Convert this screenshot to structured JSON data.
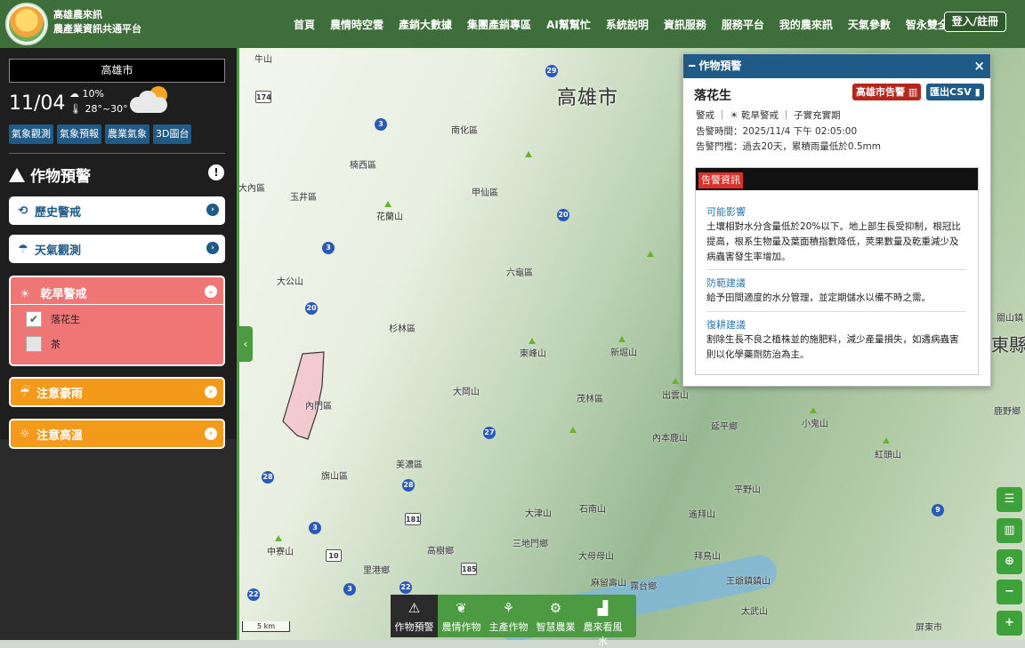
{
  "header": {
    "brand_line1": "高雄農來訊",
    "brand_line2": "農產業資訊共通平台",
    "nav": [
      "首頁",
      "農情時空雲",
      "產銷大數據",
      "集團產銷專區",
      "AI幫幫忙",
      "系統說明",
      "資訊服務",
      "服務平台",
      "我的農來訊",
      "天氣參數",
      "智永雙全"
    ],
    "login_label": "登入/註冊"
  },
  "sidebar": {
    "city": "高雄市",
    "date": "11/04",
    "rain_prob": "10%",
    "temp_range": "28°~30°",
    "weather_tabs": [
      "氣象觀測",
      "氣象預報",
      "農業氣象",
      "3D圖台"
    ],
    "section_title": "作物預警",
    "info_label": "!",
    "menu": {
      "history": "歷史警戒",
      "weather_obs": "天氣觀測",
      "drought": "乾旱警戒",
      "rain": "注意豪雨",
      "heat": "注意高溫"
    },
    "drought_crops": [
      {
        "name": "落花生",
        "checked": true
      },
      {
        "name": "茶",
        "checked": false
      }
    ]
  },
  "map": {
    "city_label": "高雄市",
    "labels": [
      "牛山",
      "甲仙區",
      "南化區",
      "楠西區",
      "大內區",
      "玉井區",
      "花蘭山",
      "大公山",
      "內門區",
      "杉林區",
      "六龜區",
      "茂林區",
      "旗山區",
      "美濃區",
      "高樹鄉",
      "三地門鄉",
      "中寮山",
      "里港鄉",
      "大岡山",
      "東峰山",
      "新堀山",
      "出雲山",
      "內本鹿山",
      "延平鄉",
      "小鬼山",
      "紅頭山",
      "平野山",
      "遙拜山",
      "拜鳥山",
      "大津山",
      "石南山",
      "大母母山",
      "霧台鄉",
      "麻留壽山",
      "王爺鎮鎮山",
      "太武山",
      "屏東市",
      "東縣",
      "鹿野鄉",
      "關山鎮"
    ],
    "scale": "5 km",
    "collapse_label": "‹"
  },
  "popup": {
    "title": "作物預警",
    "close_label": "×",
    "crop": "落花生",
    "btn_city_alert": "高雄市告警",
    "btn_export": "匯出CSV",
    "level": "警戒",
    "alert_type": "乾旱警戒",
    "stage": "子實充實期",
    "time_label": "告警時間：",
    "time_value": "2025/11/4 下午 02:05:00",
    "threshold_label": "告警門檻：",
    "threshold_value": "過去20天，累積雨量低於0.5mm",
    "info_tag": "告警資訊",
    "sections": [
      {
        "title": "可能影響",
        "body": "土壤相對水分含量低於20%以下。地上部生長受抑制，根冠比提高，根系生物量及葉面積指數降低，莢果數量及乾重減少及病蟲害發生率增加。"
      },
      {
        "title": "防範建議",
        "body": "給予田間適度的水分管理，並定期儲水以備不時之需。"
      },
      {
        "title": "復耕建議",
        "body": "割除生長不良之植株並的施肥料，減少產量損失，如遇病蟲害則以化學藥劑防治為主。"
      }
    ]
  },
  "bottom_toolbar": [
    "作物預警",
    "農情作物",
    "主產作物",
    "智慧農業",
    "農來看風水"
  ]
}
